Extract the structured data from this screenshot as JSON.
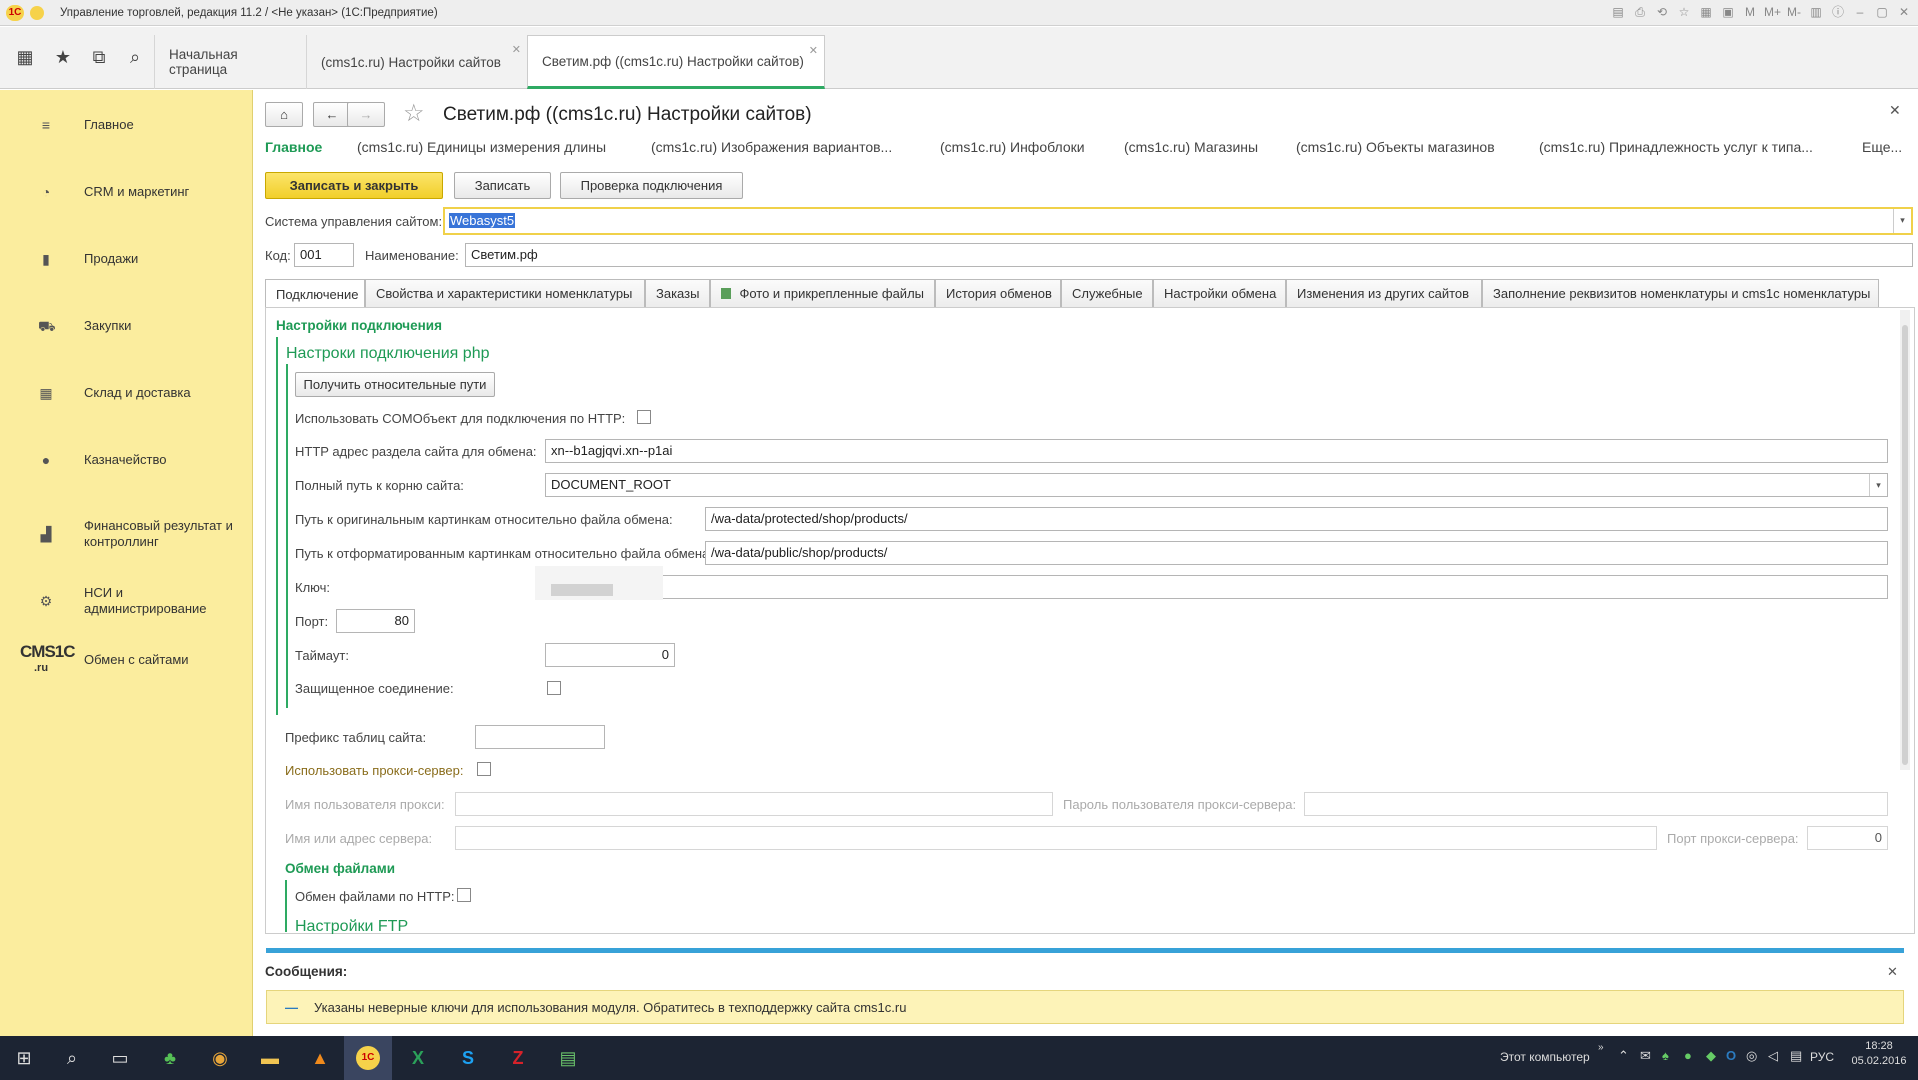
{
  "window": {
    "title": "Управление торговлей, редакция 11.2 / <Не указан>  (1С:Предприятие)"
  },
  "tabs": [
    {
      "label": "Начальная страница"
    },
    {
      "label": "(cms1c.ru) Настройки сайтов"
    },
    {
      "label": "Светим.рф ((cms1c.ru) Настройки сайтов)"
    }
  ],
  "sidebar": {
    "items": [
      {
        "label": "Главное",
        "icon": "menu-icon"
      },
      {
        "label": "CRM и маркетинг",
        "icon": "pie-chart-icon"
      },
      {
        "label": "Продажи",
        "icon": "bag-icon"
      },
      {
        "label": "Закупки",
        "icon": "cart-icon"
      },
      {
        "label": "Склад и доставка",
        "icon": "grid-icon"
      },
      {
        "label": "Казначейство",
        "icon": "coin-icon"
      },
      {
        "label": "Финансовый результат и контроллинг",
        "icon": "bar-chart-icon"
      },
      {
        "label": "НСИ и администрирование",
        "icon": "gear-icon"
      },
      {
        "label": "Обмен с сайтами",
        "icon": "cms1c-logo"
      }
    ],
    "logo_text": "CMS1C",
    "logo_sub": ".ru"
  },
  "form": {
    "title": "Светим.рф ((cms1c.ru) Настройки сайтов)",
    "nav_links": [
      "Главное",
      "(cms1c.ru) Единицы измерения длины",
      "(cms1c.ru) Изображения вариантов...",
      "(cms1c.ru) Инфоблоки",
      "(cms1c.ru) Магазины",
      "(cms1c.ru) Объекты магазинов",
      "(cms1c.ru) Принадлежность услуг к типа...",
      "Еще..."
    ],
    "buttons": {
      "save_close": "Записать и закрыть",
      "save": "Записать",
      "check": "Проверка подключения"
    },
    "cms_label": "Система управления сайтом:",
    "cms_value": "Webasyst5",
    "code_label": "Код:",
    "code_value": "001",
    "name_label": "Наименование:",
    "name_value": "Светим.рф",
    "page_tabs": [
      "Подключение",
      "Свойства и характеристики номенклатуры",
      "Заказы",
      "Фото и прикрепленные файлы",
      "История обменов",
      "Служебные",
      "Настройки обмена",
      "Изменения из других сайтов",
      "Заполнение реквизитов номенклатуры и cms1c номенклатуры"
    ],
    "connection": {
      "section_title": "Настройки подключения",
      "php_title": "Настроки подключения php",
      "get_paths_button": "Получить относительные пути",
      "com_label": "Использовать COMОбъект для подключения по HTTP:",
      "http_label": "HTTP адрес раздела сайта для обмена:",
      "http_value": "xn--b1agjqvi.xn--p1ai",
      "root_label": "Полный путь к корню сайта:",
      "root_value": "DOCUMENT_ROOT",
      "orig_label": "Путь к оригинальным картинкам относительно файла обмена:",
      "orig_value": "/wa-data/protected/shop/products/",
      "fmt_label": "Путь к отформатированным картинкам относительно файла обмена:",
      "fmt_value": "/wa-data/public/shop/products/",
      "key_label": "Ключ:",
      "port_label": "Порт:",
      "port_value": "80",
      "timeout_label": "Таймаут:",
      "timeout_value": "0",
      "secure_label": "Защищенное соединение:",
      "prefix_label": "Префикс таблиц сайта:",
      "proxy_label": "Использовать прокси-сервер:",
      "proxy_user_label": "Имя пользователя прокси:",
      "proxy_pass_label": "Пароль пользователя прокси-сервера:",
      "proxy_host_label": "Имя или адрес сервера:",
      "proxy_port_label": "Порт прокси-сервера:",
      "proxy_port_value": "0",
      "files_title": "Обмен файлами",
      "files_http_label": "Обмен файлами по HTTP:",
      "ftp_title": "Настройки FTP"
    }
  },
  "messages": {
    "title": "Сообщения:",
    "items": [
      "Указаны неверные ключи для использования модуля. Обратитесь в техподдержку сайта cms1c.ru"
    ]
  },
  "taskbar": {
    "computer_label": "Этот компьютер",
    "lang": "РУС",
    "time": "18:28",
    "date": "05.02.2016"
  }
}
